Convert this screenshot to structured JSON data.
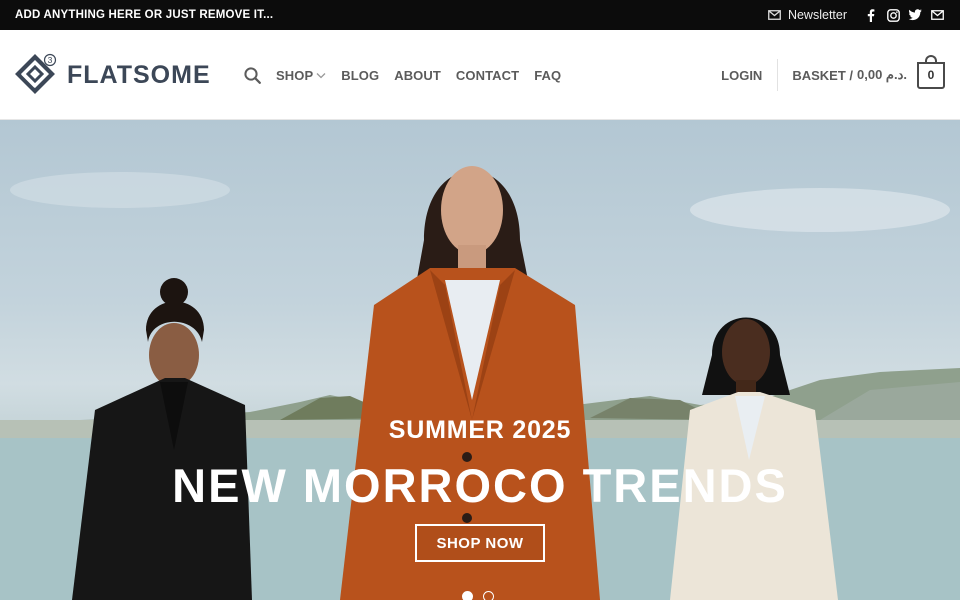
{
  "topbar": {
    "message": "ADD ANYTHING HERE OR JUST REMOVE IT...",
    "newsletter_label": "Newsletter",
    "social_icons": [
      "facebook-icon",
      "instagram-icon",
      "twitter-icon",
      "email-icon"
    ]
  },
  "header": {
    "logo_text": "FLATSOME",
    "logo_badge": "3",
    "nav": [
      {
        "label": "SHOP",
        "has_dropdown": true
      },
      {
        "label": "BLOG"
      },
      {
        "label": "ABOUT"
      },
      {
        "label": "CONTACT"
      },
      {
        "label": "FAQ"
      }
    ],
    "login_label": "LOGIN",
    "basket_label": "BASKET /",
    "basket_amount": "0,00 د.م.",
    "cart_count": "0"
  },
  "hero": {
    "subtitle": "SUMMER 2025",
    "title": "NEW MORROCO TRENDS",
    "button_label": "SHOP NOW",
    "slides": 2,
    "active_slide": 1
  }
}
